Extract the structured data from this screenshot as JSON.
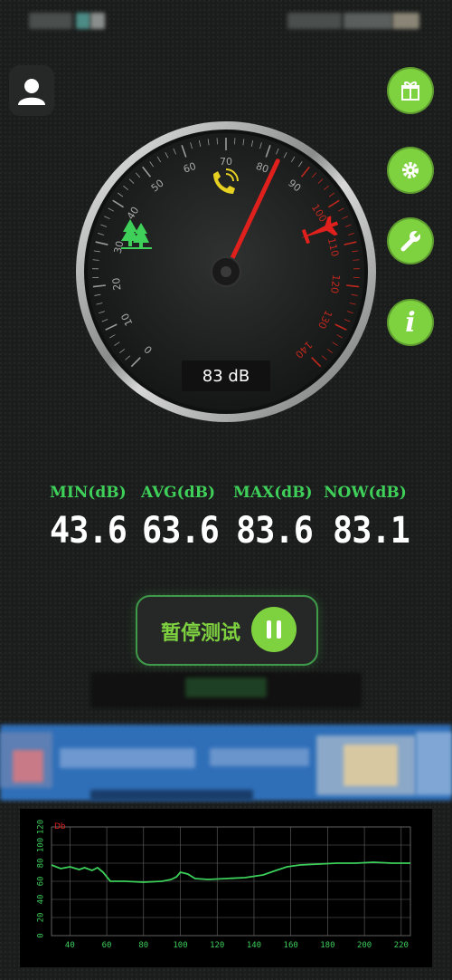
{
  "stats": {
    "min": {
      "label": "MIN(dB)",
      "value": "43.6"
    },
    "avg": {
      "label": "AVG(dB)",
      "value": "63.6"
    },
    "max": {
      "label": "MAX(dB)",
      "value": "83.6"
    },
    "now": {
      "label": "NOW(dB)",
      "value": "83.1"
    }
  },
  "gauge": {
    "readout": "83 dB",
    "value": 83,
    "min": 0,
    "max": 140,
    "ticks": [
      "0",
      "10",
      "20",
      "30",
      "40",
      "50",
      "60",
      "70",
      "80",
      "90",
      "100",
      "110",
      "120",
      "130",
      "140"
    ]
  },
  "controls": {
    "pause_label": "暂停测试"
  },
  "icons": {
    "user": "user-icon",
    "gift": "gift-icon",
    "settings": "gear-icon",
    "tools": "wrench-icon",
    "info": "info-icon",
    "tree": "tree-icon",
    "phone": "phone-icon",
    "plane": "airplane-icon",
    "pause": "pause-icon"
  },
  "colors": {
    "accent": "#7ed13f",
    "label_green": "#3fd05a",
    "needle": "#e0201c",
    "chart_line": "#3ccf5a"
  },
  "chart_data": {
    "type": "line",
    "unit_label": "Db",
    "yticks": [
      "0",
      "20",
      "40",
      "60",
      "80",
      "100",
      "120"
    ],
    "xticks": [
      "40",
      "60",
      "80",
      "100",
      "120",
      "140",
      "160",
      "180",
      "200",
      "220"
    ],
    "ylim": [
      0,
      120
    ],
    "xlim": [
      30,
      225
    ],
    "series": [
      {
        "values": [
          [
            30,
            78
          ],
          [
            35,
            74
          ],
          [
            40,
            76
          ],
          [
            45,
            73
          ],
          [
            48,
            75
          ],
          [
            52,
            72
          ],
          [
            55,
            75
          ],
          [
            58,
            70
          ],
          [
            62,
            60
          ],
          [
            70,
            60
          ],
          [
            80,
            59
          ],
          [
            90,
            60
          ],
          [
            95,
            62
          ],
          [
            98,
            65
          ],
          [
            100,
            70
          ],
          [
            104,
            68
          ],
          [
            108,
            63
          ],
          [
            115,
            62
          ],
          [
            125,
            63
          ],
          [
            135,
            64
          ],
          [
            145,
            67
          ],
          [
            152,
            72
          ],
          [
            158,
            76
          ],
          [
            165,
            78
          ],
          [
            175,
            79
          ],
          [
            185,
            80
          ],
          [
            195,
            80
          ],
          [
            205,
            81
          ],
          [
            215,
            80
          ],
          [
            225,
            80
          ]
        ]
      }
    ]
  }
}
